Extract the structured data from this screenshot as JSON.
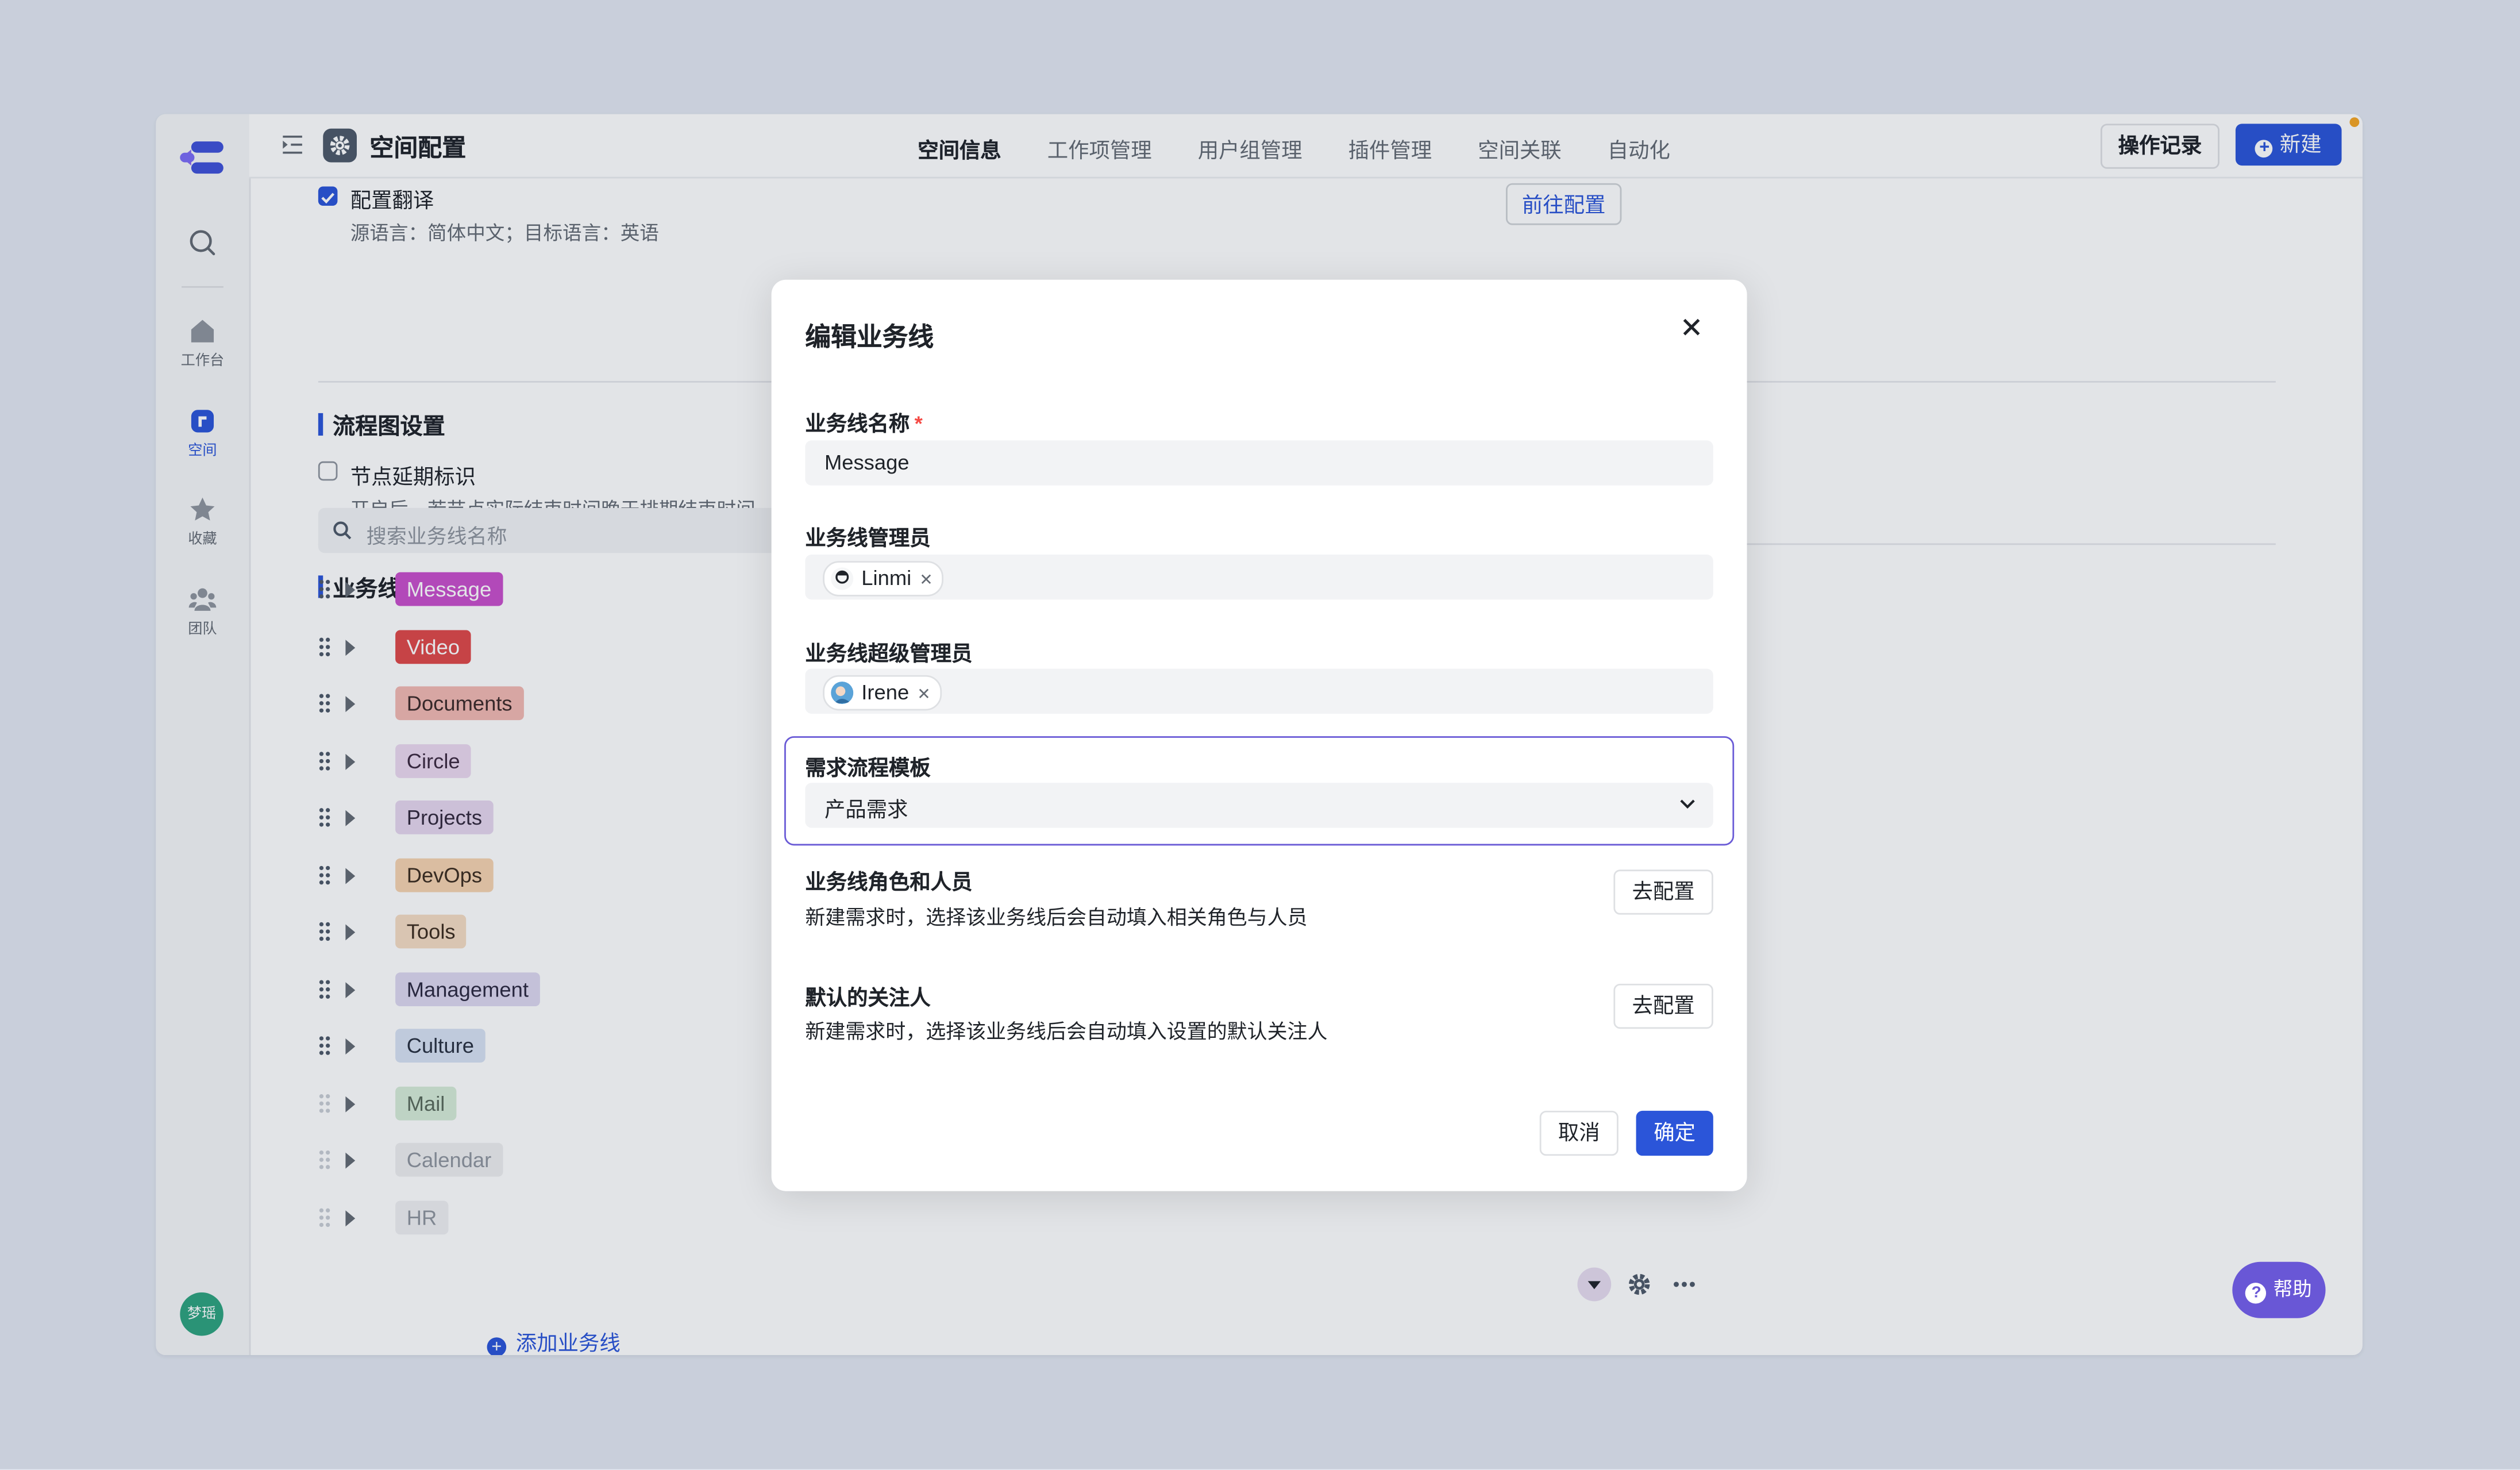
{
  "sidebar": {
    "nav": [
      {
        "label": "工作台",
        "icon": "home-icon"
      },
      {
        "label": "空间",
        "icon": "space-icon",
        "active": true
      },
      {
        "label": "收藏",
        "icon": "star-icon"
      },
      {
        "label": "团队",
        "icon": "team-icon"
      }
    ],
    "avatar": "梦瑶"
  },
  "header": {
    "title": "空间配置",
    "tabs": [
      "空间信息",
      "工作项管理",
      "用户组管理",
      "插件管理",
      "空间关联",
      "自动化"
    ],
    "active_tab": "空间信息",
    "log_button": "操作记录",
    "new_button": "新建"
  },
  "content": {
    "translate": {
      "label": "配置翻译",
      "checked": true,
      "desc": "源语言：简体中文；目标语言：英语",
      "goto_button": "前往配置"
    },
    "flow": {
      "title": "流程图设置",
      "delay_label": "节点延期标识",
      "delay_checked": false,
      "delay_desc": "开启后，若节点实际结束时间晚于排期结束时间"
    },
    "business": {
      "title": "业务线配置",
      "search_placeholder": "搜索业务线名称",
      "lines": [
        {
          "name": "Message",
          "bg": "#c94fcb",
          "fg": "#ffffff"
        },
        {
          "name": "Video",
          "bg": "#e04848",
          "fg": "#ffffff"
        },
        {
          "name": "Documents",
          "bg": "#f3b9b2",
          "fg": "#3d2a28"
        },
        {
          "name": "Circle",
          "bg": "#ecd9ef",
          "fg": "#3d2a40"
        },
        {
          "name": "Projects",
          "bg": "#e6d6ee",
          "fg": "#33283d"
        },
        {
          "name": "DevOps",
          "bg": "#f6d3b0",
          "fg": "#3d2d1f"
        },
        {
          "name": "Tools",
          "bg": "#f5dcc3",
          "fg": "#3d2d1f"
        },
        {
          "name": "Management",
          "bg": "#ddd8f0",
          "fg": "#2c2840"
        },
        {
          "name": "Culture",
          "bg": "#d8e2f3",
          "fg": "#283040"
        },
        {
          "name": "Mail",
          "bg": "#d6ecd8",
          "fg": "#5a6a5c"
        },
        {
          "name": "Calendar",
          "bg": "#eeeef0",
          "fg": "#8f959e"
        },
        {
          "name": "HR",
          "bg": "#f0f0f2",
          "fg": "#8f959e"
        }
      ],
      "add_label": "添加业务线"
    },
    "help_label": "帮助"
  },
  "modal": {
    "title": "编辑业务线",
    "name_label": "业务线名称",
    "name_value": "Message",
    "admin_label": "业务线管理员",
    "admin_chip": "Linmi",
    "super_label": "业务线超级管理员",
    "super_chip": "Irene",
    "template_label": "需求流程模板",
    "template_value": "产品需求",
    "roles_label": "业务线角色和人员",
    "roles_desc": "新建需求时，选择该业务线后会自动填入相关角色与人员",
    "roles_button": "去配置",
    "watch_label": "默认的关注人",
    "watch_desc": "新建需求时，选择该业务线后会自动填入设置的默认关注人",
    "watch_button": "去配置",
    "cancel": "取消",
    "ok": "确定"
  },
  "colors": {
    "accent": "#2b55d9",
    "focus": "#6a5bd6",
    "help": "#6957d6",
    "avatar": "#2ea37f"
  }
}
